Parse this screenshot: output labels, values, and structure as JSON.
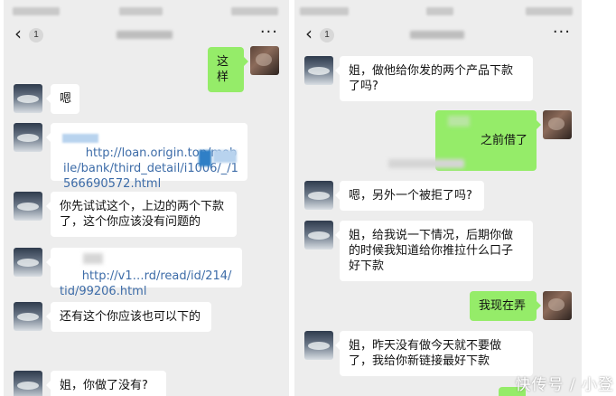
{
  "left_chat": {
    "back_count": "1",
    "more_label": "···",
    "messages": [
      {
        "from": "self",
        "text": "这样"
      },
      {
        "from": "other",
        "text": "嗯"
      },
      {
        "from": "other",
        "text": "http://loan.origin.top/mobile/bank/third_detail/i1006/_/1566690572.html"
      },
      {
        "from": "other",
        "text": "你先试试这个，上边的两个下款了，这个你应该没有问题的"
      },
      {
        "from": "other",
        "text": "http://v1…rd/read/id/214/tid/99206.html"
      },
      {
        "from": "other",
        "text": "还有这个你应该也可以下的"
      },
      {
        "from": "other",
        "text": "姐，你做了没有?"
      }
    ]
  },
  "right_chat": {
    "back_count": "1",
    "more_label": "···",
    "messages": [
      {
        "from": "other",
        "text": "姐，做他给你发的两个产品下款了吗?"
      },
      {
        "from": "self",
        "text": "之前借了"
      },
      {
        "from": "other",
        "text": "嗯，另外一个被拒了吗?"
      },
      {
        "from": "other",
        "text": "姐，给我说一下情况，后期你做的时候我知道给你推拉什么口子好下款"
      },
      {
        "from": "self",
        "text": "我现在弄"
      },
      {
        "from": "other",
        "text": "姐，昨天没有做今天就不要做了，我给你新链接最好下款"
      }
    ]
  },
  "watermark": "快传号 / 小登"
}
